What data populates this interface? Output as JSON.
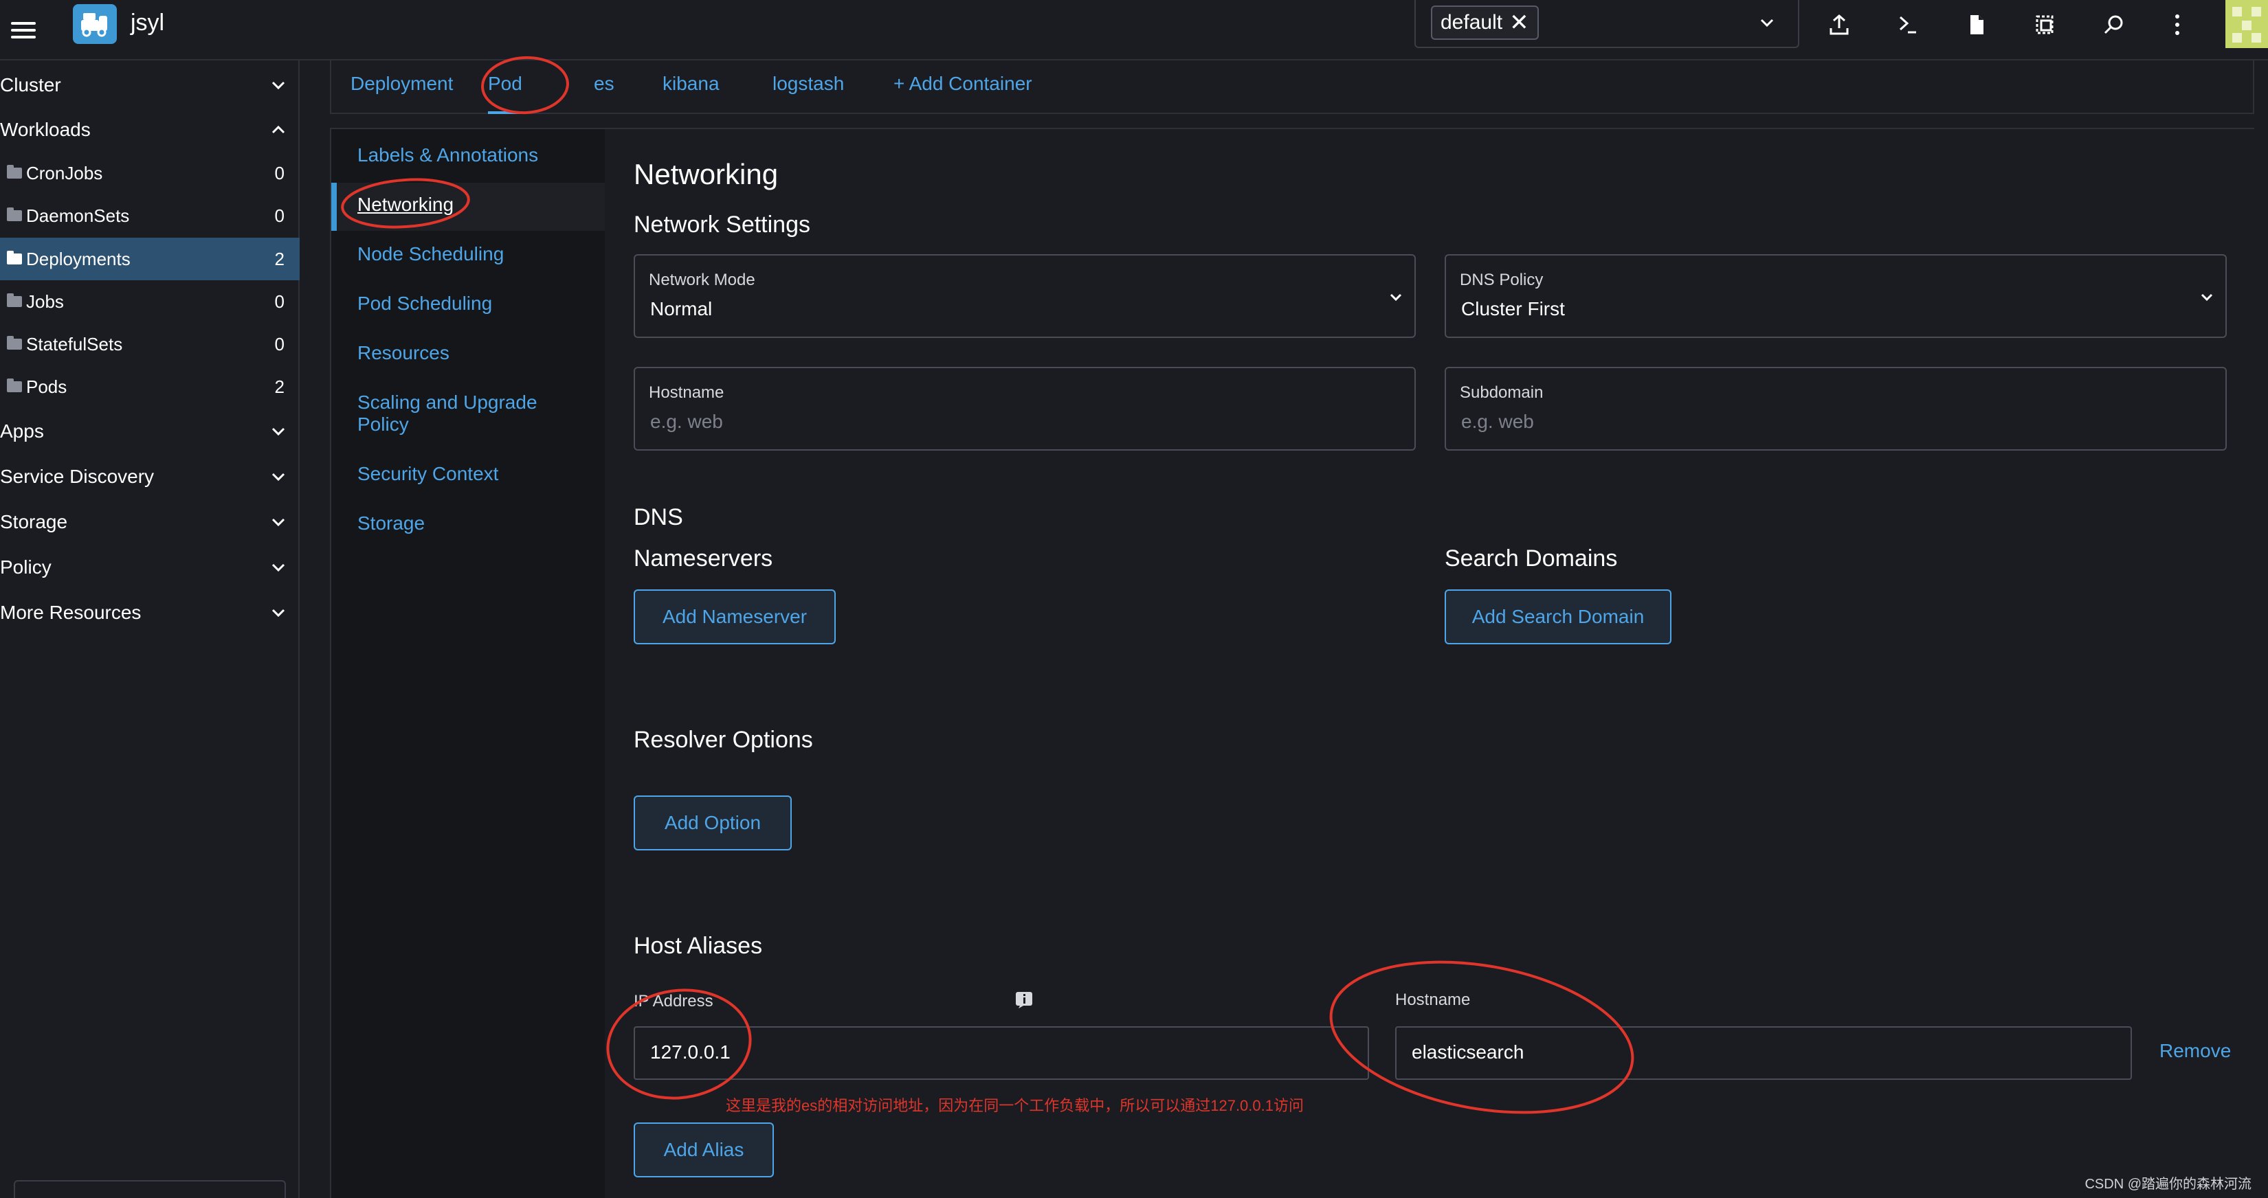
{
  "header": {
    "cluster_name": "jsyl",
    "namespace_chip": "default",
    "namespace_chip_remove": "✕"
  },
  "sidenav": {
    "groups_top": [
      {
        "label": "Cluster",
        "expanded": false
      },
      {
        "label": "Workloads",
        "expanded": true
      }
    ],
    "workload_items": [
      {
        "label": "CronJobs",
        "count": "0"
      },
      {
        "label": "DaemonSets",
        "count": "0"
      },
      {
        "label": "Deployments",
        "count": "2",
        "active": true
      },
      {
        "label": "Jobs",
        "count": "0"
      },
      {
        "label": "StatefulSets",
        "count": "0"
      },
      {
        "label": "Pods",
        "count": "2"
      }
    ],
    "groups_bottom": [
      {
        "label": "Apps"
      },
      {
        "label": "Service Discovery"
      },
      {
        "label": "Storage"
      },
      {
        "label": "Policy"
      },
      {
        "label": "More Resources"
      }
    ]
  },
  "tabs": {
    "items": [
      "Deployment",
      "Pod",
      "es",
      "kibana",
      "logstash"
    ],
    "add_container": "+ Add Container",
    "active": "Pod"
  },
  "subnav": {
    "items": [
      "Labels & Annotations",
      "Networking",
      "Node Scheduling",
      "Pod Scheduling",
      "Resources",
      "Scaling and Upgrade Policy",
      "Security Context",
      "Storage"
    ],
    "active": "Networking"
  },
  "content": {
    "title": "Networking",
    "network_settings_title": "Network Settings",
    "network_mode": {
      "label": "Network Mode",
      "value": "Normal"
    },
    "dns_policy": {
      "label": "DNS Policy",
      "value": "Cluster First"
    },
    "hostname": {
      "label": "Hostname",
      "placeholder": "e.g. web"
    },
    "subdomain": {
      "label": "Subdomain",
      "placeholder": "e.g. web"
    },
    "dns_title": "DNS",
    "nameservers_title": "Nameservers",
    "search_domains_title": "Search Domains",
    "add_nameserver": "Add Nameserver",
    "add_search_domain": "Add Search Domain",
    "resolver_title": "Resolver Options",
    "add_option": "Add Option",
    "host_aliases_title": "Host Aliases",
    "alias_ip_label": "IP Address",
    "alias_hostname_label": "Hostname",
    "alias_ip_value": "127.0.0.1",
    "alias_hostname_value": "elasticsearch",
    "remove": "Remove",
    "add_alias": "Add Alias",
    "annotation_note": "这里是我的es的相对访问地址，因为在同一个工作负载中，所以可以通过127.0.0.1访问"
  },
  "watermark": "CSDN @踏遍你的森林河流",
  "colors": {
    "accent": "#4ea6e8",
    "active_nav": "#2d5170",
    "annotation": "#e0352b"
  }
}
